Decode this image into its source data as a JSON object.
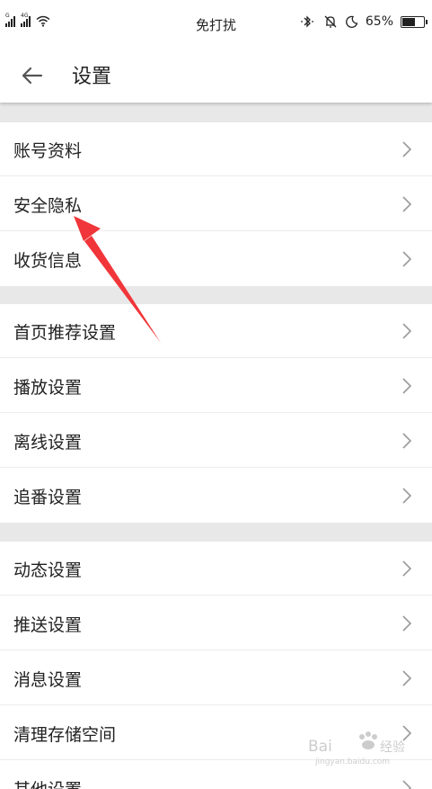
{
  "status_bar": {
    "sim1_tag": "G",
    "sim2_tag": "4G",
    "center_text": "免打扰",
    "battery_text": "65%",
    "battery_level": 0.65
  },
  "header": {
    "title": "设置",
    "back_icon": "arrow-left-icon"
  },
  "groups": [
    {
      "items": [
        "账号资料",
        "安全隐私",
        "收货信息"
      ]
    },
    {
      "items": [
        "首页推荐设置",
        "播放设置",
        "离线设置",
        "追番设置"
      ]
    },
    {
      "items": [
        "动态设置",
        "推送设置",
        "消息设置",
        "清理存储空间",
        "其他设置"
      ]
    }
  ],
  "colors": {
    "group_gap": "#e8e8e8",
    "annotation_arrow": "#f0363a",
    "chevron": "#9a9a9a"
  }
}
